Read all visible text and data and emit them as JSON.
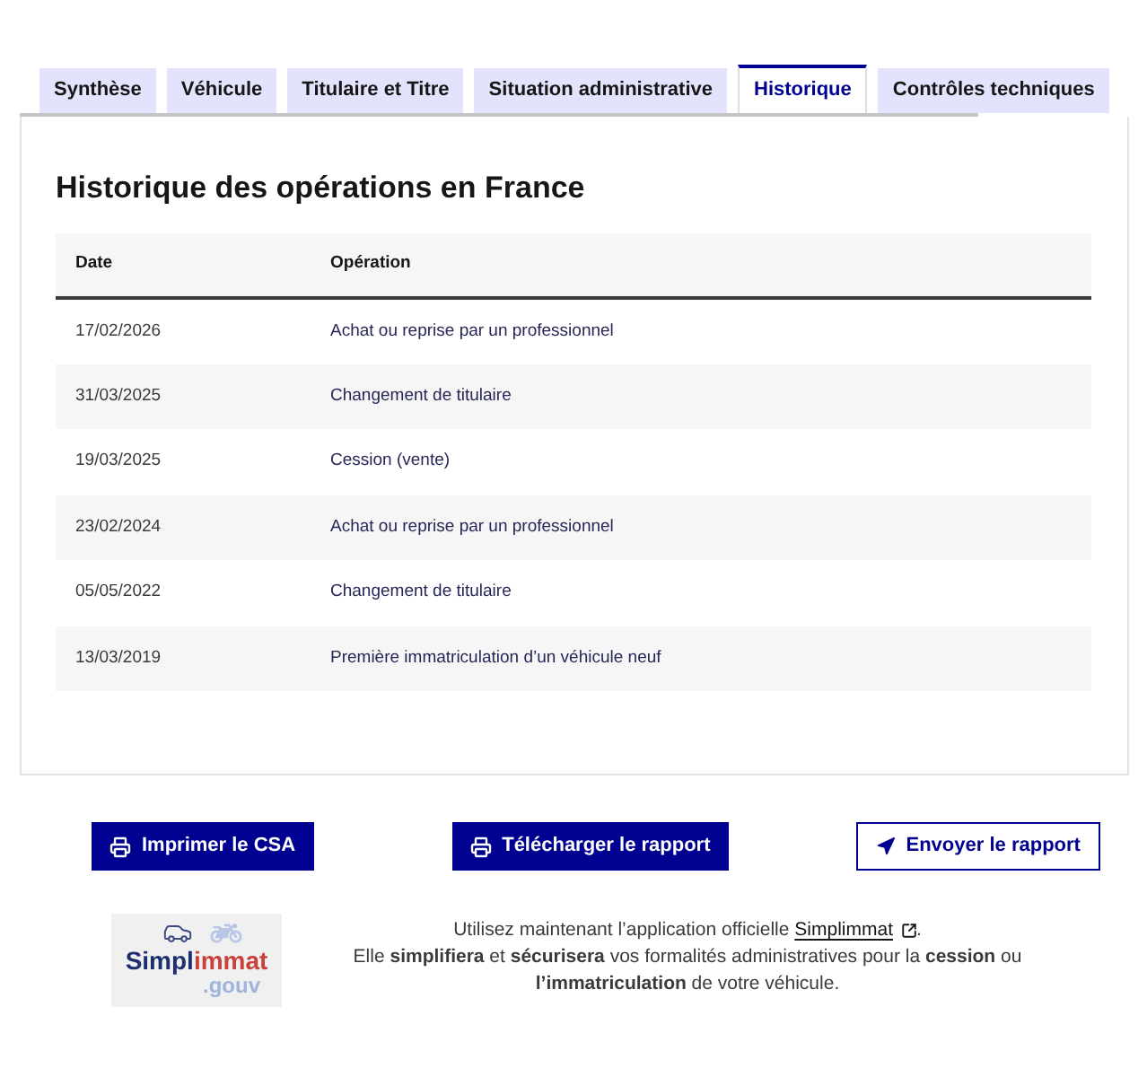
{
  "tabs": [
    {
      "label": "Synthèse",
      "selected": false
    },
    {
      "label": "Véhicule",
      "selected": false
    },
    {
      "label": "Titulaire et Titre",
      "selected": false
    },
    {
      "label": "Situation administrative",
      "selected": false
    },
    {
      "label": "Historique",
      "selected": true
    },
    {
      "label": "Contrôles techniques",
      "selected": false
    }
  ],
  "panel": {
    "title": "Historique des opérations en France",
    "table": {
      "columns": [
        "Date",
        "Opération"
      ],
      "rows": [
        {
          "date": "17/02/2026",
          "operation": "Achat ou reprise par un professionnel"
        },
        {
          "date": "31/03/2025",
          "operation": "Changement de titulaire"
        },
        {
          "date": "19/03/2025",
          "operation": "Cession (vente)"
        },
        {
          "date": "23/02/2024",
          "operation": "Achat ou reprise par un professionnel"
        },
        {
          "date": "05/05/2022",
          "operation": "Changement de titulaire"
        },
        {
          "date": "13/03/2019",
          "operation": "Première immatriculation d’un véhicule neuf"
        }
      ]
    }
  },
  "actions": [
    {
      "label": "Imprimer le CSA",
      "kind": "primary"
    },
    {
      "label": "Télécharger le rapport",
      "kind": "primary"
    },
    {
      "label": "Envoyer le rapport",
      "kind": "secondary"
    }
  ],
  "promo": {
    "logo": {
      "name_part_1": "Simpl",
      "name_part_2": "immat",
      "suffix": ".gouv"
    },
    "text_before_link": "Utilisez maintenant l’application officielle",
    "link": "Simplimmat",
    "text_after_link": ".",
    "text_second": "Elle **simplifiera** et **sécurisera** vos formalités administratives pour la **cession** ou **l’immatriculation** de votre véhicule."
  }
}
